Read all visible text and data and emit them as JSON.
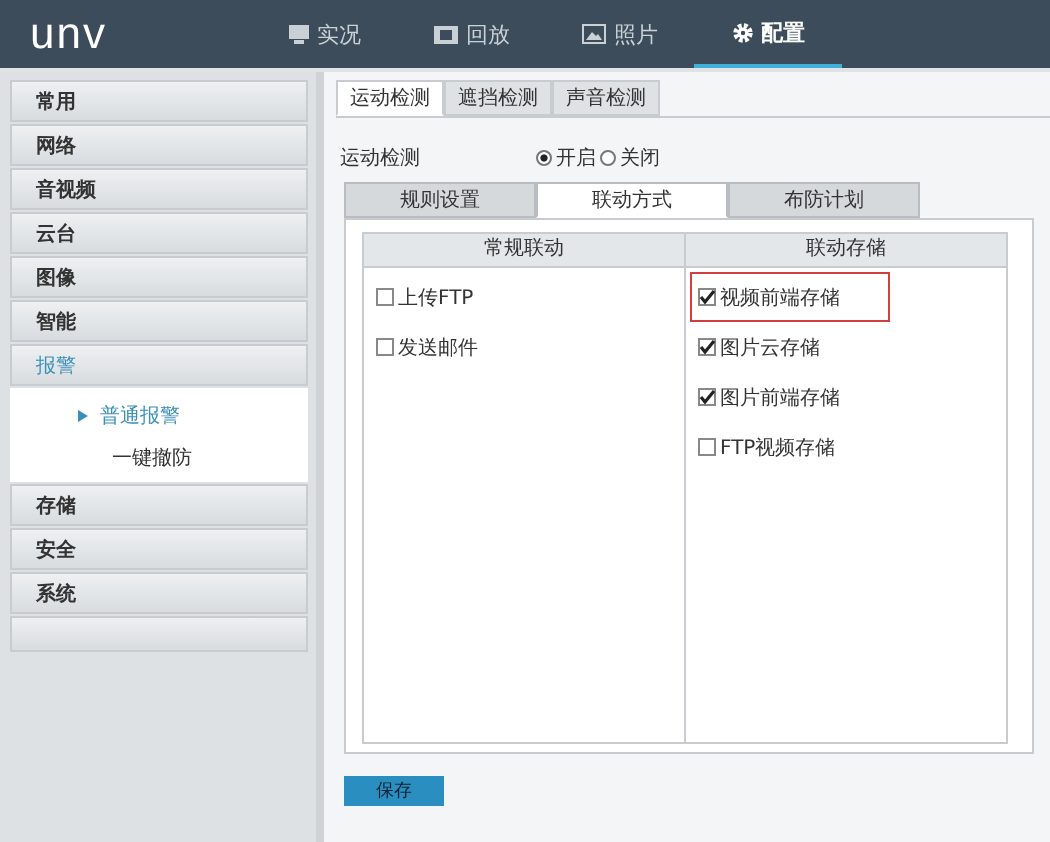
{
  "header": {
    "logo": "unv",
    "nav": [
      {
        "label": "实况",
        "kind": "monitor",
        "selected": false
      },
      {
        "label": "回放",
        "kind": "film",
        "selected": false
      },
      {
        "label": "照片",
        "kind": "photo",
        "selected": false
      },
      {
        "label": "配置",
        "kind": "gear",
        "selected": true
      }
    ]
  },
  "sidebar": {
    "items": [
      {
        "label": "常用",
        "selected": false
      },
      {
        "label": "网络",
        "selected": false
      },
      {
        "label": "音视频",
        "selected": false
      },
      {
        "label": "云台",
        "selected": false
      },
      {
        "label": "图像",
        "selected": false
      },
      {
        "label": "智能",
        "selected": false
      },
      {
        "label": "报警",
        "selected": true,
        "expanded": true,
        "children": [
          {
            "label": "普通报警",
            "selected": true
          },
          {
            "label": "一键撤防",
            "selected": false
          }
        ]
      },
      {
        "label": "存储",
        "selected": false
      },
      {
        "label": "安全",
        "selected": false
      },
      {
        "label": "系统",
        "selected": false
      }
    ]
  },
  "tabs": [
    {
      "label": "运动检测",
      "selected": true
    },
    {
      "label": "遮挡检测",
      "selected": false
    },
    {
      "label": "声音检测",
      "selected": false
    }
  ],
  "motion_detection": {
    "label": "运动检测",
    "options": [
      {
        "label": "开启",
        "selected": true
      },
      {
        "label": "关闭",
        "selected": false
      }
    ]
  },
  "sub_tabs": [
    {
      "label": "规则设置",
      "selected": false
    },
    {
      "label": "联动方式",
      "selected": true
    },
    {
      "label": "布防计划",
      "selected": false
    }
  ],
  "linkage": {
    "columns": [
      {
        "title": "常规联动",
        "items": [
          {
            "label": "上传FTP",
            "checked": false,
            "highlighted": false
          },
          {
            "label": "发送邮件",
            "checked": false,
            "highlighted": false
          }
        ]
      },
      {
        "title": "联动存储",
        "items": [
          {
            "label": "视频前端存储",
            "checked": true,
            "highlighted": true
          },
          {
            "label": "图片云存储",
            "checked": true,
            "highlighted": false
          },
          {
            "label": "图片前端存储",
            "checked": true,
            "highlighted": false
          },
          {
            "label": "FTP视频存储",
            "checked": false,
            "highlighted": false
          }
        ]
      }
    ]
  },
  "save_button": "保存"
}
